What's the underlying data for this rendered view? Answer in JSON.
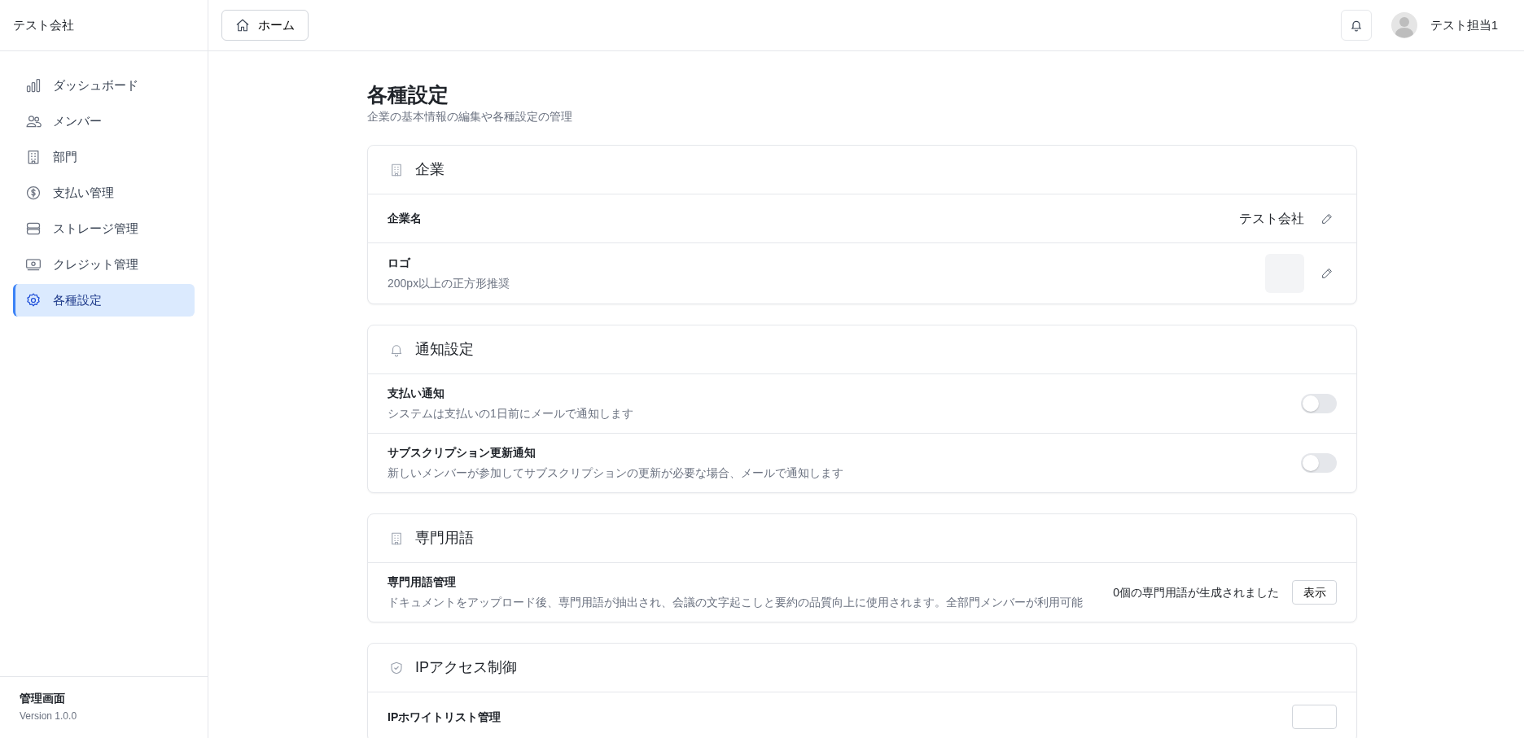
{
  "sidebar": {
    "company": "テスト会社",
    "items": [
      {
        "label": "ダッシュボード",
        "selected": false
      },
      {
        "label": "メンバー",
        "selected": false
      },
      {
        "label": "部門",
        "selected": false
      },
      {
        "label": "支払い管理",
        "selected": false
      },
      {
        "label": "ストレージ管理",
        "selected": false
      },
      {
        "label": "クレジット管理",
        "selected": false
      },
      {
        "label": "各種設定",
        "selected": true
      }
    ],
    "footer": {
      "title": "管理画面",
      "version": "Version 1.0.0"
    }
  },
  "header": {
    "home_button": "ホーム",
    "user_name": "テスト担当1"
  },
  "page": {
    "title": "各種設定",
    "subtitle": "企業の基本情報の編集や各種設定の管理"
  },
  "sections": [
    {
      "title": "企業",
      "rows": [
        {
          "kind": "text",
          "label": "企業名",
          "value": "テスト会社"
        },
        {
          "kind": "image",
          "label": "ロゴ",
          "description": "200px以上の正方形推奨"
        }
      ]
    },
    {
      "title": "通知設定",
      "rows": [
        {
          "kind": "toggle",
          "label": "支払い通知",
          "description": "システムは支払いの1日前にメールで通知します",
          "on": false
        },
        {
          "kind": "toggle",
          "label": "サブスクリプション更新通知",
          "description": "新しいメンバーが参加してサブスクリプションの更新が必要な場合、メールで通知します",
          "on": false
        }
      ]
    },
    {
      "title": "専門用語",
      "rows": [
        {
          "kind": "action",
          "label": "専門用語管理",
          "description": "ドキュメントをアップロード後、専門用語が抽出され、会議の文字起こしと要約の品質向上に使用されます。全部門メンバーが利用可能",
          "value": "0個の専門用語が生成されました",
          "button": "表示"
        }
      ]
    },
    {
      "title": "IPアクセス制御",
      "rows": [
        {
          "kind": "action",
          "label": "IPホワイトリスト管理"
        }
      ]
    }
  ]
}
